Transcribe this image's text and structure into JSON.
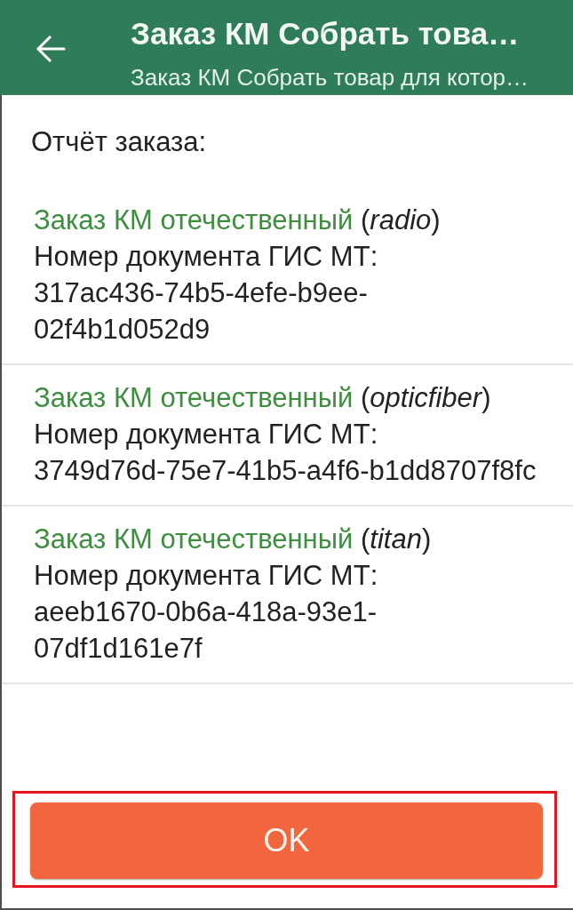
{
  "header": {
    "title": "Заказ КМ Собрать това…",
    "subtitle": "Заказ КМ Собрать товар для котор…"
  },
  "report": {
    "title": "Отчёт заказа:"
  },
  "orders": [
    {
      "name": "Заказ КМ отечественный",
      "type": "(*radio*)",
      "label": "Номер документа ГИС МТ:",
      "document_number": "317ac436-74b5-4efe-b9ee-02f4b1d052d9"
    },
    {
      "name": "Заказ КМ отечественный",
      "type": "(*opticfiber*)",
      "label": "Номер документа ГИС МТ:",
      "document_number": "3749d76d-75e7-41b5-a4f6-b1dd8707f8fc"
    },
    {
      "name": "Заказ КМ отечественный",
      "type": "(*titan*)",
      "label": "Номер документа ГИС МТ:",
      "document_number": "aeeb1670-0b6a-418a-93e1-07df1d161e7f"
    }
  ],
  "ok_button": {
    "label": "OK",
    "highlighted": true
  }
}
